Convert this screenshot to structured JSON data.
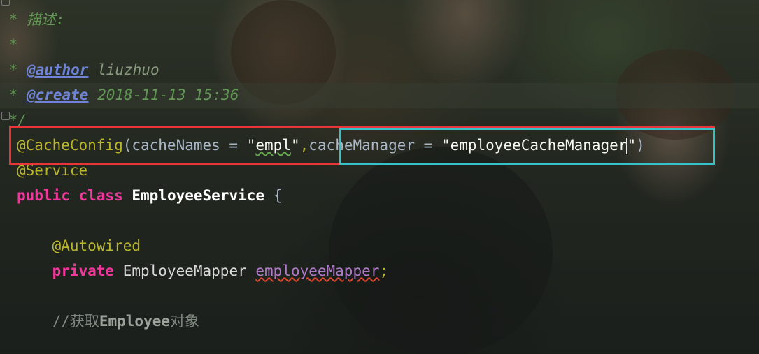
{
  "editor": {
    "lines": {
      "l1_star": " * ",
      "l1_text": "描述:",
      "l2": " *",
      "l3_star": " * ",
      "l3_tag": "@author",
      "l3_value": " liuzhuo",
      "l4_star": " * ",
      "l4_tag": "@create",
      "l4_value": " 2018-11-13 15:36",
      "l5": " */",
      "l6_anno": "@CacheConfig",
      "l6_open": "(cacheNames = ",
      "l6_str1_a": "\"",
      "l6_str1_b": "empl",
      "l6_str1_c": "\"",
      "l6_comma": ",",
      "l6_attr": "cacheManager = ",
      "l6_str2": "\"employeeCacheManager",
      "l6_str2_end": "\"",
      "l6_close": ")",
      "l7": "@Service",
      "l8_kw1": "public",
      "l8_kw2": " class ",
      "l8_cls": "EmployeeService",
      "l8_brace": " {",
      "l10": "    @Autowired",
      "l11_kw": "    private",
      "l11_type": " EmployeeMapper ",
      "l11_field": "employeeMapper",
      "l11_semi": ";",
      "l13_a": "    //获取",
      "l13_b": "Employee",
      "l13_c": "对象"
    }
  },
  "colors": {
    "red_box": "#e8353a",
    "cyan_box": "#35c3c8"
  }
}
